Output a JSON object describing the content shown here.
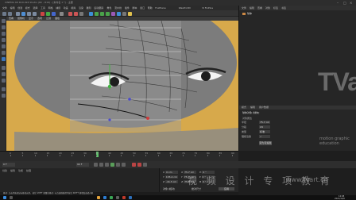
{
  "window": {
    "title": "CINEMA 4D R19.024 Studio (RC - R19) - [未命名 1 *] - 主要"
  },
  "menu": [
    "文件",
    "编辑",
    "创建",
    "模式",
    "选择",
    "工具",
    "网格",
    "捕捉",
    "动画",
    "模拟",
    "渲染",
    "雕刻",
    "运动跟踪",
    "角色",
    "流水线",
    "插件",
    "脚本",
    "窗口",
    "帮助",
    "FoxPlane",
    "WasPro3D",
    "3i FixPlus"
  ],
  "viewport": {
    "menu": [
      "查看",
      "摄像机",
      "显示",
      "选项",
      "过滤",
      "面板"
    ]
  },
  "object_manager": {
    "tabs": [
      "文件",
      "编辑",
      "查看",
      "对象",
      "标签",
      "书签"
    ],
    "object_name": "球体"
  },
  "attributes": {
    "tabs": [
      "模式",
      "编辑",
      "用户数据"
    ],
    "object_label": "球体对象 [球体]",
    "section": "对象属性",
    "rows": [
      {
        "label": "半径",
        "value": "75.7 cm"
      },
      {
        "label": "分段",
        "value": "24"
      },
      {
        "label": "类型",
        "value": "标准"
      },
      {
        "label": "理想渲染",
        "value": "✓"
      }
    ],
    "button": "转为可编辑"
  },
  "timeline": {
    "ticks": [
      "0",
      "5",
      "10",
      "15",
      "20",
      "25",
      "30",
      "35",
      "40",
      "45",
      "50",
      "55",
      "60",
      "65",
      "70",
      "75",
      "80",
      "85",
      "90"
    ],
    "current_frame": "0 F",
    "end_frame": "90 F"
  },
  "materials": {
    "tabs": [
      "创建",
      "编辑",
      "功能",
      "纹理"
    ]
  },
  "coordinates": {
    "rows": [
      {
        "a": "X",
        "av": "0 cm",
        "b": "X",
        "bv": "75.7 cm",
        "c": "H",
        "cv": "0 °"
      },
      {
        "a": "Y",
        "av": "135.4 cm",
        "b": "Y",
        "bv": "75.7 cm",
        "c": "P",
        "cv": "0 °"
      },
      {
        "a": "Z",
        "av": "-41.5 cm",
        "b": "Z",
        "bv": "75.7 cm",
        "c": "B",
        "cv": "0 °"
      }
    ],
    "mode_left": "对象 (相对)",
    "mode_right": "绝对尺寸",
    "apply": "应用"
  },
  "status": "移动: 点击并拖动鼠标移动元素。按住 SHIFT 键量化移动; 节点编辑模式时按住 SHIFT 键增加选择对象",
  "watermark": {
    "logo": "TVart",
    "sub": "motion graphic education",
    "cn": "视 频 设 计 专 项 教 育",
    "url": "www.tvart.cn"
  },
  "taskbar": {
    "time": "12:08",
    "date": "2021/12/6"
  }
}
